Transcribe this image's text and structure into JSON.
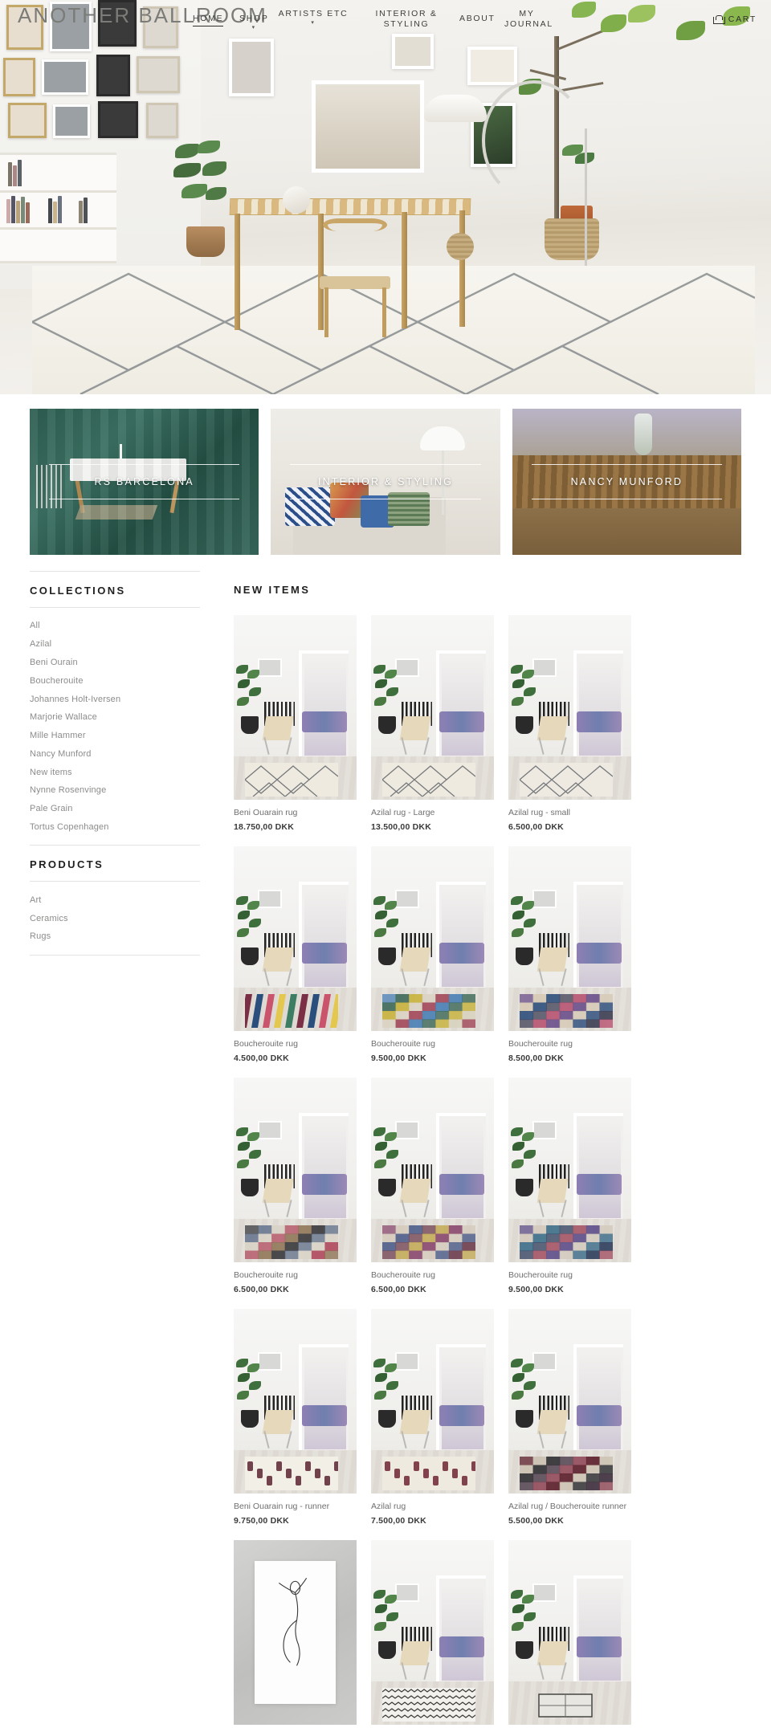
{
  "site": {
    "logo": "ANOTHER BALLROOM"
  },
  "nav": {
    "items": [
      {
        "label": "HOME",
        "caret": "",
        "active": true
      },
      {
        "label": "SHOP",
        "caret": "▾",
        "active": false
      },
      {
        "label": "ARTISTS ETC",
        "caret": "▾",
        "active": false
      },
      {
        "label": "INTERIOR & STYLING",
        "caret": "",
        "active": false
      },
      {
        "label": "ABOUT",
        "caret": "",
        "active": false
      },
      {
        "label": "MY JOURNAL",
        "caret": "",
        "active": false
      }
    ],
    "cart_label": "CART",
    "cart_icon": "cart-icon"
  },
  "banners": [
    {
      "label": "RS BARCELONA"
    },
    {
      "label": "INTERIOR & STYLING"
    },
    {
      "label": "NANCY MUNFORD"
    }
  ],
  "sidebar": {
    "collections_heading": "COLLECTIONS",
    "collections": [
      {
        "label": "All"
      },
      {
        "label": "Azilal"
      },
      {
        "label": "Beni Ourain"
      },
      {
        "label": "Boucherouite"
      },
      {
        "label": "Johannes Holt-Iversen"
      },
      {
        "label": "Marjorie Wallace"
      },
      {
        "label": "Mille Hammer"
      },
      {
        "label": "Nancy Munford"
      },
      {
        "label": "New items"
      },
      {
        "label": "Nynne Rosenvinge"
      },
      {
        "label": "Pale Grain"
      },
      {
        "label": "Tortus Copenhagen"
      }
    ],
    "products_heading": "PRODUCTS",
    "products": [
      {
        "label": "Art"
      },
      {
        "label": "Ceramics"
      },
      {
        "label": "Rugs"
      }
    ]
  },
  "main": {
    "heading": "NEW ITEMS",
    "products": [
      {
        "title": "Beni Ouarain rug",
        "price": "18.750,00 DKK",
        "rug": "diamond",
        "colors": [
          "#efeae0"
        ]
      },
      {
        "title": "Azilal rug - Large",
        "price": "13.500,00 DKK",
        "rug": "diamond",
        "colors": [
          "#efeae0"
        ]
      },
      {
        "title": "Azilal rug - small",
        "price": "6.500,00 DKK",
        "rug": "diamond",
        "colors": [
          "#eeeae2"
        ]
      },
      {
        "title": "Boucherouite rug",
        "price": "4.500,00 DKK",
        "rug": "chevron",
        "colors": [
          "#7b2f46",
          "#2b4f7d",
          "#c9546b",
          "#e4c74f",
          "#3c7d64"
        ]
      },
      {
        "title": "Boucherouite rug",
        "price": "9.500,00 DKK",
        "rug": "patch",
        "colors": [
          "#4a7fb5",
          "#c8b23e",
          "#9c3b4e",
          "#2f5f4e",
          "#d9d2c0"
        ]
      },
      {
        "title": "Boucherouite rug",
        "price": "8.500,00 DKK",
        "rug": "patch",
        "colors": [
          "#6b4f8a",
          "#2f4f7d",
          "#b5486a",
          "#d6c8b2",
          "#3f3f55"
        ]
      },
      {
        "title": "Boucherouite rug",
        "price": "6.500,00 DKK",
        "rug": "patch",
        "colors": [
          "#3a3a3f",
          "#d8d2c6",
          "#8a6f4f",
          "#5f6f8a",
          "#b04a5e"
        ]
      },
      {
        "title": "Boucherouite rug",
        "price": "6.500,00 DKK",
        "rug": "patch",
        "colors": [
          "#8a4a6f",
          "#4f5f8a",
          "#c2a84f",
          "#d4cabb",
          "#6f3f4f"
        ]
      },
      {
        "title": "Boucherouite rug",
        "price": "9.500,00 DKK",
        "rug": "patch",
        "colors": [
          "#5f4f8a",
          "#3f6f8a",
          "#a04a5e",
          "#d2c8ba",
          "#2f3f5f"
        ]
      },
      {
        "title": "Beni Ouarain rug - runner",
        "price": "9.750,00 DKK",
        "rug": "runner-dark",
        "colors": [
          "#f2efe7",
          "#5a2230"
        ]
      },
      {
        "title": "Azilal rug",
        "price": "7.500,00 DKK",
        "rug": "runner-dark",
        "colors": [
          "#efeadf",
          "#6e2434"
        ]
      },
      {
        "title": "Azilal rug / Boucherouite runner",
        "price": "5.500,00 DKK",
        "rug": "patch",
        "colors": [
          "#5c1f2b",
          "#2f2f33",
          "#8a3f4f",
          "#c9bfae",
          "#3f2f3f"
        ]
      },
      {
        "title": "",
        "price": "",
        "rug": "art-print",
        "colors": [
          "#c9c9c7"
        ]
      },
      {
        "title": "",
        "price": "",
        "rug": "zigzag",
        "colors": [
          "#f2f1ed"
        ]
      },
      {
        "title": "",
        "price": "",
        "rug": "small-mat",
        "colors": [
          "#e8e6e1"
        ]
      }
    ]
  }
}
